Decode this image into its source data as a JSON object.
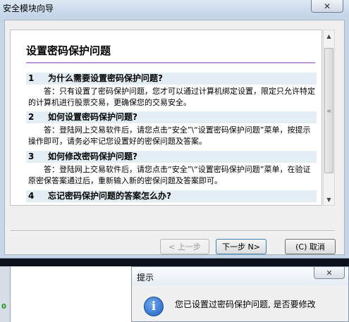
{
  "wizard": {
    "title": "安全模块向导",
    "close_glyph": "✕",
    "page_title": "设置密码保护问题",
    "faq": [
      {
        "num": "1",
        "question": "为什么需要设置密码保护问题?",
        "answer": "答：只有设置了密码保护问题，您才可以通过计算机绑定设置，限定只允许特定的计算机进行股票交易，更确保您的交易安全。"
      },
      {
        "num": "2",
        "question": "如何设置密码保护问题?",
        "answer": "答：登陆网上交易软件后，请您点击“安全”\\“设置密码保护问题”菜单，按提示操作即可，请务必牢记您设置好的密保问题及答案。"
      },
      {
        "num": "3",
        "question": "如何修改密码保护问题?",
        "answer": "答：登陆网上交易软件后，请您点击“安全”\\“设置密码保护问题”菜单，在验证原密保答案通过后，重新输入新的密保问题及答案即可。"
      },
      {
        "num": "4",
        "question": "忘记密码保护问题的答案怎么办?",
        "answer": ""
      }
    ],
    "buttons": {
      "prev": "< 上一步",
      "next": "下一步 N>",
      "cancel": "(C) 取消"
    }
  },
  "popup": {
    "title": "提示",
    "close_glyph": "✕",
    "icon_glyph": "i",
    "message": "您已设置过密码保护问题, 是否要修改"
  },
  "icons": {
    "scroll_up": "▲",
    "scroll_down": "▼",
    "scroll_grip": "≡"
  },
  "background": {
    "marker": "0"
  }
}
